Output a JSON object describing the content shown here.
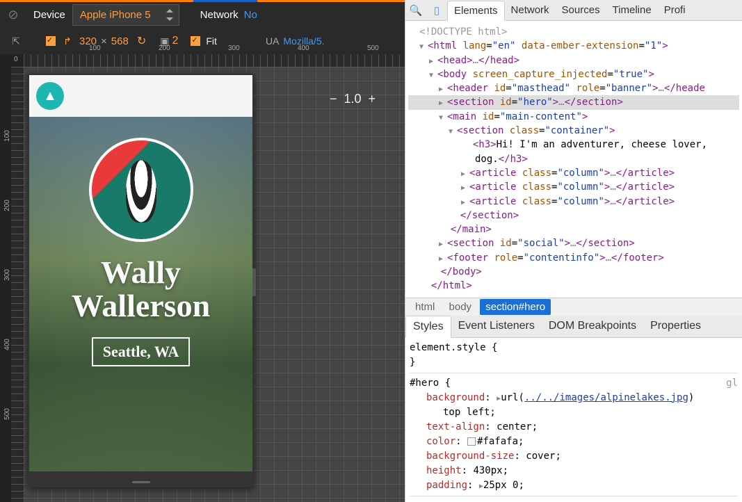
{
  "emu": {
    "device_label": "Device",
    "device_value": "Apple iPhone 5",
    "network_label": "Network",
    "network_value": "No",
    "width": "320",
    "height": "568",
    "dpr": "2",
    "fit_label": "Fit",
    "ua_label": "UA",
    "ua_value": "Mozilla/5.",
    "zoom": "1.0",
    "ruler_h": [
      "100",
      "200",
      "300",
      "400",
      "500"
    ],
    "ruler_v": [
      "100",
      "200",
      "300",
      "400",
      "500"
    ]
  },
  "preview": {
    "name_line1": "Wally",
    "name_line2": "Wallerson",
    "location": "Seattle, WA"
  },
  "devtools": {
    "tabs": [
      "Elements",
      "Network",
      "Sources",
      "Timeline",
      "Profi"
    ],
    "dom": {
      "doctype": "<!DOCTYPE html>",
      "html_open": {
        "tag": "html",
        "attrs": [
          [
            "lang",
            "en"
          ],
          [
            "data-ember-extension",
            "1"
          ]
        ]
      },
      "head": "head",
      "body_open": {
        "tag": "body",
        "attrs": [
          [
            "screen_capture_injected",
            "true"
          ]
        ]
      },
      "header": {
        "tag": "header",
        "attrs": [
          [
            "id",
            "masthead"
          ],
          [
            "role",
            "banner"
          ]
        ]
      },
      "section_hero": {
        "tag": "section",
        "attrs": [
          [
            "id",
            "hero"
          ]
        ]
      },
      "main": {
        "tag": "main",
        "attrs": [
          [
            "id",
            "main-content"
          ]
        ]
      },
      "section_container": {
        "tag": "section",
        "attrs": [
          [
            "class",
            "container"
          ]
        ]
      },
      "h3_text": "Hi! I'm an adventurer, cheese lover, dog.",
      "article": {
        "tag": "article",
        "attrs": [
          [
            "class",
            "column"
          ]
        ]
      },
      "section_social": {
        "tag": "section",
        "attrs": [
          [
            "id",
            "social"
          ]
        ]
      },
      "footer": {
        "tag": "footer",
        "attrs": [
          [
            "role",
            "contentinfo"
          ]
        ]
      }
    },
    "crumbs": [
      "html",
      "body",
      "section#hero"
    ],
    "style_tabs": [
      "Styles",
      "Event Listeners",
      "DOM Breakpoints",
      "Properties"
    ],
    "styles": {
      "element_style": "element.style {",
      "rule": {
        "selector": "#hero {",
        "src_hint": "gl",
        "props": [
          {
            "name": "background",
            "val_pre": "url(",
            "link": "../../images/alpinelakes.jpg",
            "val_post": ") top left;",
            "tri": true,
            "multiline": true
          },
          {
            "name": "text-align",
            "val": "center;"
          },
          {
            "name": "color",
            "val": "#fafafa;",
            "swatch": true
          },
          {
            "name": "background-size",
            "val": "cover;"
          },
          {
            "name": "height",
            "val": "430px;"
          },
          {
            "name": "padding",
            "val": "25px 0;",
            "tri": true
          }
        ]
      }
    }
  }
}
